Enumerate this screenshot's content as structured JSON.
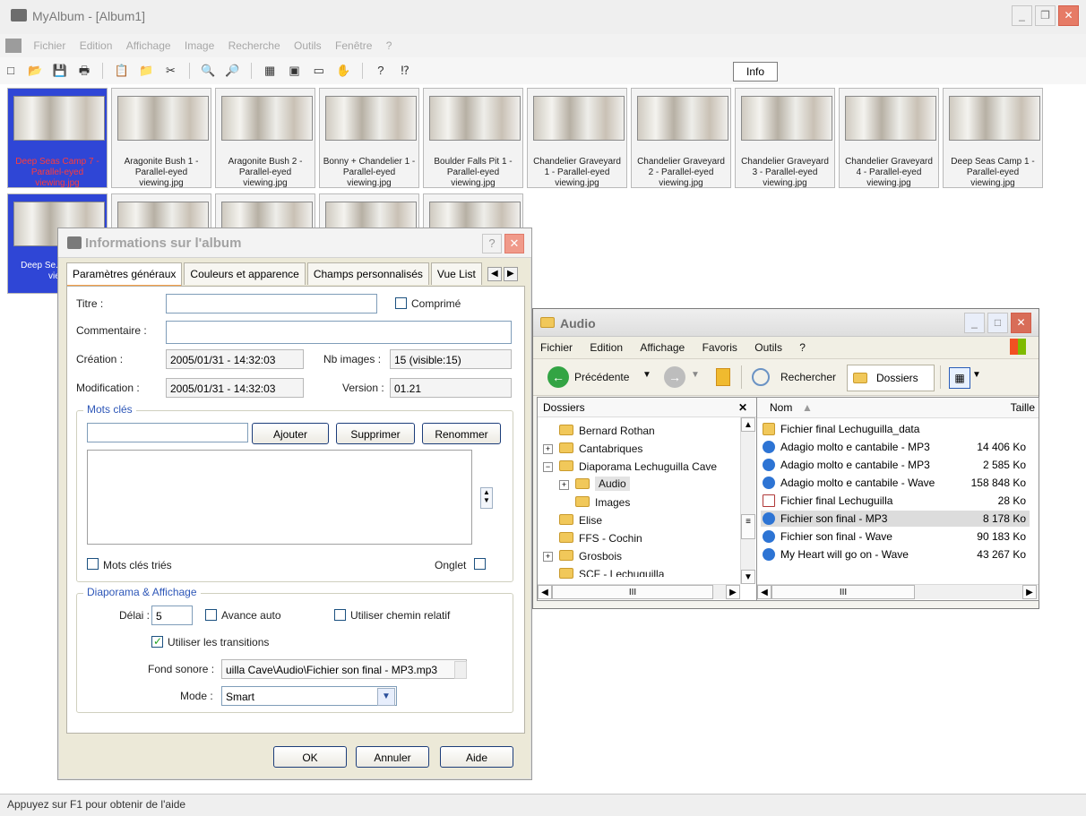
{
  "app": {
    "title": "MyAlbum - [Album1]",
    "menu": [
      "Fichier",
      "Edition",
      "Affichage",
      "Image",
      "Recherche",
      "Outils",
      "Fenêtre",
      "?"
    ],
    "info_button": "Info",
    "status_text": "Appuyez sur F1 pour obtenir de l'aide"
  },
  "thumbnails": [
    {
      "label": "Deep Seas Camp 7 - Parallel-eyed viewing.jpg",
      "selected": true
    },
    {
      "label": "Aragonite Bush 1 - Parallel-eyed viewing.jpg"
    },
    {
      "label": "Aragonite Bush 2 - Parallel-eyed viewing.jpg"
    },
    {
      "label": "Bonny + Chandelier 1 - Parallel-eyed viewing.jpg"
    },
    {
      "label": "Boulder Falls Pit 1 - Parallel-eyed viewing.jpg"
    },
    {
      "label": "Chandelier Graveyard 1 - Parallel-eyed viewing.jpg"
    },
    {
      "label": "Chandelier Graveyard 2 - Parallel-eyed viewing.jpg"
    },
    {
      "label": "Chandelier Graveyard 3 - Parallel-eyed viewing.jpg"
    },
    {
      "label": "Chandelier Graveyard 4 - Parallel-eyed viewing.jpg"
    },
    {
      "label": "Deep Seas Camp 1 - Parallel-eyed viewing.jpg"
    },
    {
      "label": "Deep Se... Paral... view"
    },
    {
      "label": ""
    },
    {
      "label": ""
    },
    {
      "label": ""
    },
    {
      "label": ""
    }
  ],
  "dialog": {
    "title": "Informations sur l'album",
    "tabs": [
      "Paramètres généraux",
      "Couleurs et apparence",
      "Champs personnalisés",
      "Vue List"
    ],
    "titre_label": "Titre :",
    "titre_value": "",
    "comprime_label": "Comprimé",
    "commentaire_label": "Commentaire :",
    "commentaire_value": "",
    "creation_label": "Création :",
    "creation_value": "2005/01/31 - 14:32:03",
    "nb_images_label": "Nb images :",
    "nb_images_value": "15 (visible:15)",
    "modification_label": "Modification :",
    "modification_value": "2005/01/31 - 14:32:03",
    "version_label": "Version :",
    "version_value": "01.21",
    "mots_cles_title": "Mots clés",
    "mots_cle_input": "",
    "ajouter": "Ajouter",
    "supprimer": "Supprimer",
    "renommer": "Renommer",
    "mots_cles_tries": "Mots clés triés",
    "onglet": "Onglet",
    "diaporama_title": "Diaporama & Affichage",
    "delai_label": "Délai :",
    "delai_value": "5",
    "avance_auto": "Avance auto",
    "utiliser_chemin_relatif": "Utiliser chemin relatif",
    "utiliser_transitions": "Utiliser les transitions",
    "fond_sonore_label": "Fond sonore :",
    "fond_sonore_value": "uilla Cave\\Audio\\Fichier son final - MP3.mp3",
    "mode_label": "Mode :",
    "mode_value": "Smart",
    "ok": "OK",
    "annuler": "Annuler",
    "aide": "Aide"
  },
  "explorer": {
    "title": "Audio",
    "menu": [
      "Fichier",
      "Edition",
      "Affichage",
      "Favoris",
      "Outils",
      "?"
    ],
    "back": "Précédente",
    "search": "Rechercher",
    "folders": "Dossiers",
    "left_header": "Dossiers",
    "tree": [
      "Bernard Rothan",
      "Cantabriques",
      "Diaporama Lechuguilla Cave",
      "Audio",
      "Images",
      "Elise",
      "FFS - Cochin",
      "Grosbois",
      "SCF - Lechuguilla"
    ],
    "col_name": "Nom",
    "col_size": "Taille",
    "files": [
      {
        "name": "Fichier final Lechuguilla_data",
        "size": ""
      },
      {
        "name": "Adagio molto e cantabile - MP3",
        "size": "14 406 Ko"
      },
      {
        "name": "Adagio molto e cantabile - MP3",
        "size": "2 585 Ko"
      },
      {
        "name": "Adagio molto e cantabile - Wave",
        "size": "158 848 Ko"
      },
      {
        "name": "Fichier final Lechuguilla",
        "size": "28 Ko"
      },
      {
        "name": "Fichier son final - MP3",
        "size": "8 178 Ko",
        "selected": true
      },
      {
        "name": "Fichier son final - Wave",
        "size": "90 183 Ko"
      },
      {
        "name": "My Heart will go on - Wave",
        "size": "43 267 Ko"
      }
    ]
  }
}
